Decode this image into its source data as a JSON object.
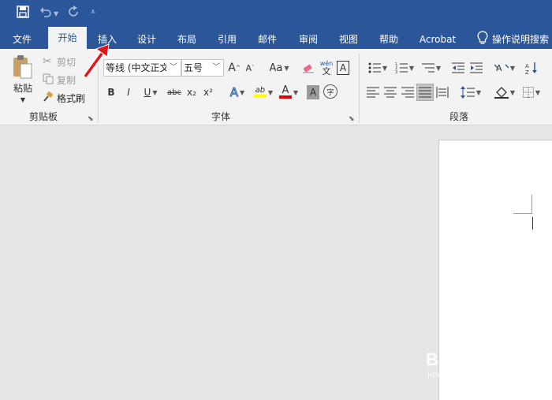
{
  "tabs": [
    "文件",
    "开始",
    "插入",
    "设计",
    "布局",
    "引用",
    "邮件",
    "审阅",
    "视图",
    "帮助",
    "Acrobat"
  ],
  "tell_me": "操作说明搜索",
  "clipboard": {
    "paste": "粘贴",
    "cut": "剪切",
    "copy": "复制",
    "format_painter": "格式刷",
    "label": "剪贴板"
  },
  "font": {
    "font_name": "等线 (中文正文)",
    "font_size": "五号",
    "label": "字体",
    "grow_font": "A",
    "shrink_font": "A",
    "change_case": "Aa",
    "phonetic_top": "wén",
    "phonetic_bottom": "文",
    "char_border": "A",
    "bold": "B",
    "italic": "I",
    "underline": "U",
    "strike": "abc",
    "subscript": "x₂",
    "superscript": "x²",
    "text_effects": "A",
    "highlight": "ab",
    "font_color": "A",
    "char_shading": "A",
    "enclose_char": "字",
    "colors": {
      "highlight": "#ffff00",
      "font_color": "#e00000"
    }
  },
  "paragraph": {
    "label": "段落"
  },
  "watermark": {
    "brand": "Baidu 经验",
    "url": "jingyan.baidu.com"
  },
  "colors": {
    "title_bar": "#2b579a",
    "ribbon": "#f3f3f3",
    "arrow": "#e0161b"
  }
}
